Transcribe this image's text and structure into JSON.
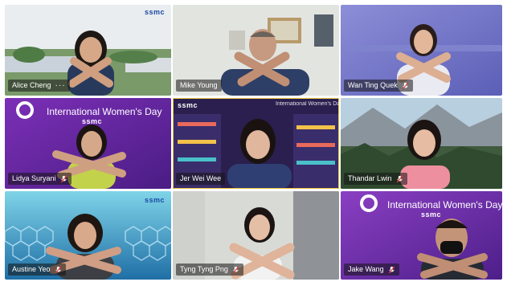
{
  "brand": "ssmc",
  "event_title": "International Women's Day",
  "participants": [
    {
      "name": "Alice Cheng",
      "indicator": "more"
    },
    {
      "name": "Mike Young",
      "indicator": "none"
    },
    {
      "name": "Wan Ting Quek",
      "indicator": "mic-muted"
    },
    {
      "name": "Lidya Suryani",
      "indicator": "mic-muted"
    },
    {
      "name": "Jer Wei Wee",
      "indicator": "none"
    },
    {
      "name": "Thandar Lwin",
      "indicator": "mic-muted"
    },
    {
      "name": "Austine Yeo",
      "indicator": "mic-muted"
    },
    {
      "name": "Tyng Tyng Png",
      "indicator": "mic-muted"
    },
    {
      "name": "Jake Wang",
      "indicator": "mic-muted"
    }
  ],
  "colors": {
    "brand_blue": "#1b4aa0",
    "iwd_purple": "#6a2ca8",
    "active_speaker": "#e8c33a"
  }
}
